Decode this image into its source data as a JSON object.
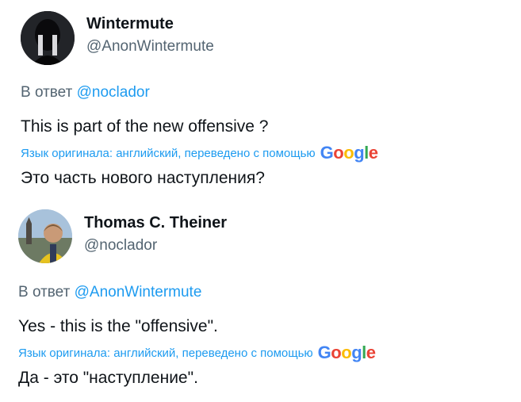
{
  "tweets": [
    {
      "name": "Wintermute",
      "handle": "@AnonWintermute",
      "reply_prefix": "В ответ",
      "reply_to": "@noclador",
      "text": "This is part of the new offensive ?",
      "translation_note": "Язык оригинала: английский, переведено с помощью",
      "translated_text": "Это часть нового наступления?"
    },
    {
      "name": "Thomas C. Theiner",
      "handle": "@noclador",
      "reply_prefix": "В ответ",
      "reply_to": "@AnonWintermute",
      "text": "Yes - this is the \"offensive\".",
      "translation_note": "Язык оригинала: английский, переведено с помощью",
      "translated_text": "Да - это \"наступление\"."
    }
  ],
  "google_logo": [
    "G",
    "o",
    "o",
    "g",
    "l",
    "e"
  ],
  "colors": {
    "link": "#1d9bf0",
    "secondary": "#536471",
    "primary": "#0f1419"
  }
}
